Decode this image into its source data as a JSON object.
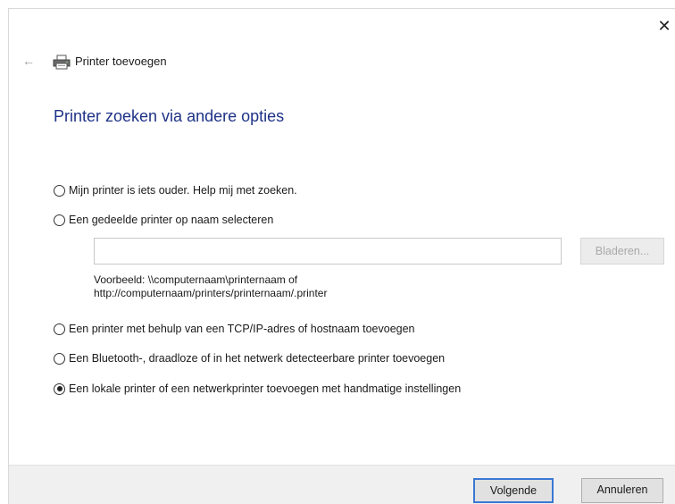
{
  "window": {
    "title": "Printer toevoegen",
    "close_label": "✕"
  },
  "nav": {
    "back_icon": "back-arrow-icon",
    "back_label": "←",
    "printer_icon": "printer-icon"
  },
  "page": {
    "heading": "Printer zoeken via andere opties"
  },
  "options": [
    {
      "label": "Mijn printer is iets ouder. Help mij met zoeken.",
      "checked": false
    },
    {
      "label": "Een gedeelde printer op naam selecteren",
      "checked": false
    },
    {
      "label": "Een printer met behulp van een TCP/IP-adres of hostnaam toevoegen",
      "checked": false
    },
    {
      "label": "Een Bluetooth-, draadloze of in het netwerk detecteerbare printer toevoegen",
      "checked": false
    },
    {
      "label": "Een lokale printer of een netwerkprinter toevoegen met handmatige instellingen",
      "checked": true
    }
  ],
  "shared_printer": {
    "input_value": "",
    "browse_label": "Bladeren...",
    "example_line1": "Voorbeeld: \\\\computernaam\\printernaam of",
    "example_line2": "http://computernaam/printers/printernaam/.printer"
  },
  "footer": {
    "next_label": "Volgende",
    "cancel_label": "Annuleren"
  },
  "colors": {
    "heading": "#1e3287",
    "focus_border": "#3a78d4",
    "footer_bg": "#f0f0f0"
  }
}
